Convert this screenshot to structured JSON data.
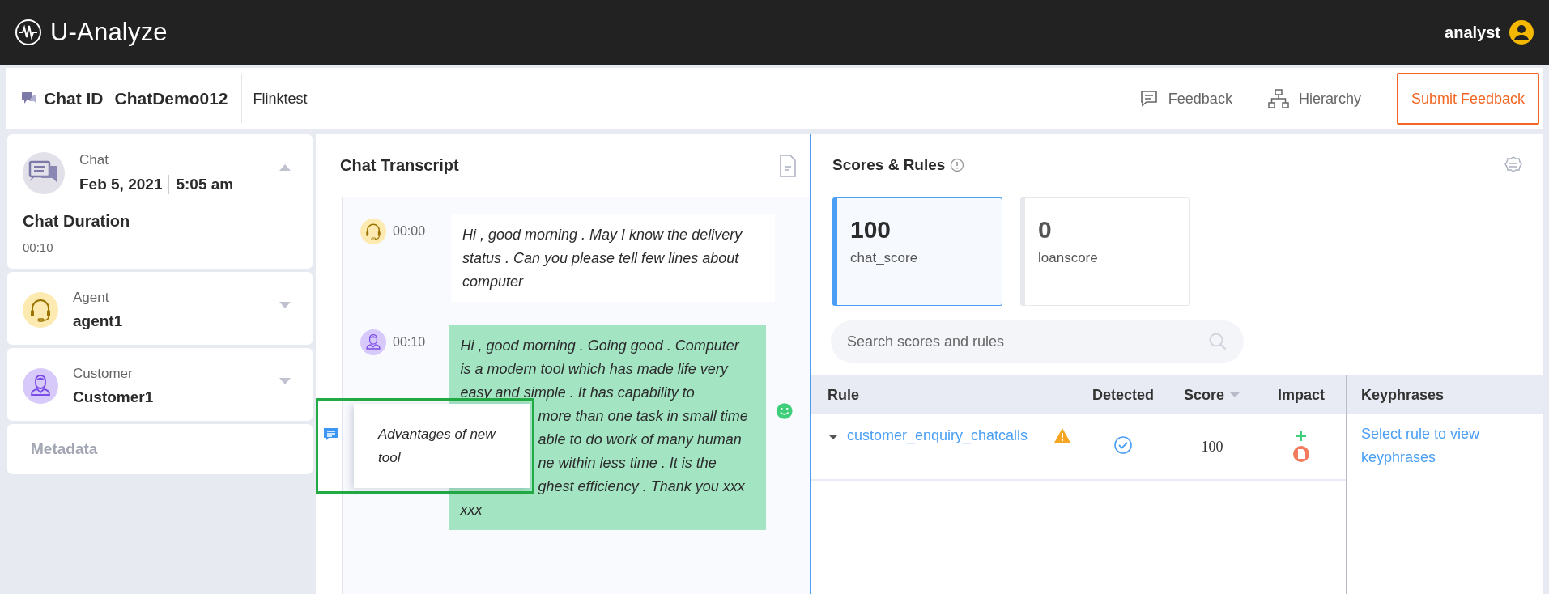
{
  "app": {
    "title": "U-Analyze",
    "user": "analyst"
  },
  "header": {
    "chat_id_label": "Chat ID",
    "chat_id": "ChatDemo012",
    "tenant": "Flinktest",
    "actions": [
      {
        "kind": "feedback",
        "label": "Feedback"
      },
      {
        "kind": "hierarchy",
        "label": "Hierarchy"
      }
    ],
    "submit": "Submit Feedback"
  },
  "sidebar": {
    "cards": [
      {
        "kind": "chat",
        "label": "Chat",
        "date": "Feb 5, 2021",
        "time": "5:05 am",
        "expanded": true,
        "duration_label": "Chat Duration",
        "duration": "00:10"
      },
      {
        "kind": "agent",
        "label": "Agent",
        "value": "agent1",
        "expanded": false
      },
      {
        "kind": "customer",
        "label": "Customer",
        "value": "Customer1",
        "expanded": false
      }
    ],
    "metadata": "Metadata"
  },
  "transcript": {
    "title": "Chat Transcript",
    "messages": [
      {
        "kind": "agent",
        "time": "00:00",
        "smiley": false,
        "lines": [
          {
            "text": "Hi , good morning . May I know the delivery"
          },
          {
            "text": "status . Can you please tell few lines about"
          },
          {
            "text": "computer"
          }
        ]
      },
      {
        "kind": "customer",
        "time": "00:10",
        "smiley": true,
        "lines": [
          {
            "text": "Hi , good morning . Going good . Computer",
            "covered": false
          },
          {
            "text": "is a modern tool which has made life very",
            "covered": false
          },
          {
            "text": "easy and simple . It has capability to",
            "covered": false
          },
          {
            "text": "more than one task in small time",
            "covered": true
          },
          {
            "text": "able to do work of many human",
            "covered": true
          },
          {
            "text": "ne within less time . It is the",
            "covered": true
          },
          {
            "text": "ghest efficiency . Thank you xxx",
            "covered": true
          },
          {
            "text": "xxx",
            "covered": false
          }
        ]
      }
    ],
    "note": "Advantages of new tool"
  },
  "scores": {
    "title": "Scores & Rules",
    "cards": [
      {
        "value": "100",
        "name": "chat_score",
        "selected": true
      },
      {
        "value": "0",
        "name": "loanscore",
        "selected": false
      }
    ],
    "search": {
      "placeholder": "Search scores and rules"
    },
    "columns": [
      "Rule",
      "Detected",
      "Score",
      "Impact"
    ],
    "rows": [
      {
        "rule": "customer_enquiry_chatcalls",
        "detected": true,
        "score": "100"
      }
    ],
    "keyphrases": {
      "title": "Keyphrases",
      "hint": "Select rule to view keyphrases"
    }
  }
}
